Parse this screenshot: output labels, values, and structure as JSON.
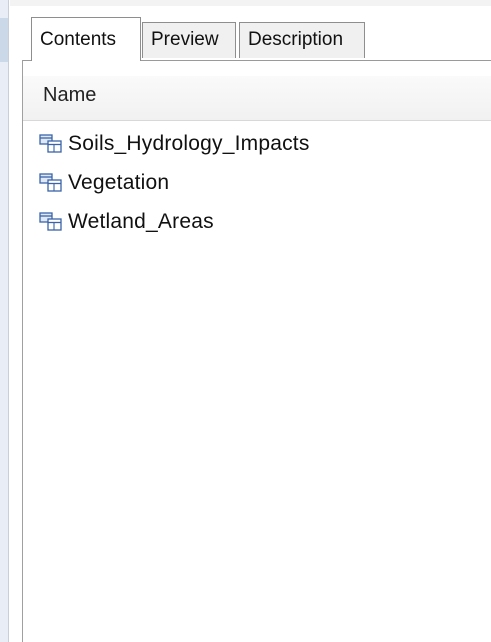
{
  "tabs": {
    "contents": "Contents",
    "preview": "Preview",
    "description": "Description"
  },
  "header": {
    "name_label": "Name"
  },
  "items": [
    {
      "label": "Soils_Hydrology_Impacts",
      "icon": "layer-group-icon"
    },
    {
      "label": "Vegetation",
      "icon": "layer-group-icon"
    },
    {
      "label": "Wetland_Areas",
      "icon": "layer-group-icon"
    }
  ],
  "colors": {
    "icon_stroke": "#3a63a8",
    "icon_fill": "#dfe8f5",
    "tab_border": "#8e8e8e",
    "tab_inactive_bg": "#f0f0f0"
  }
}
